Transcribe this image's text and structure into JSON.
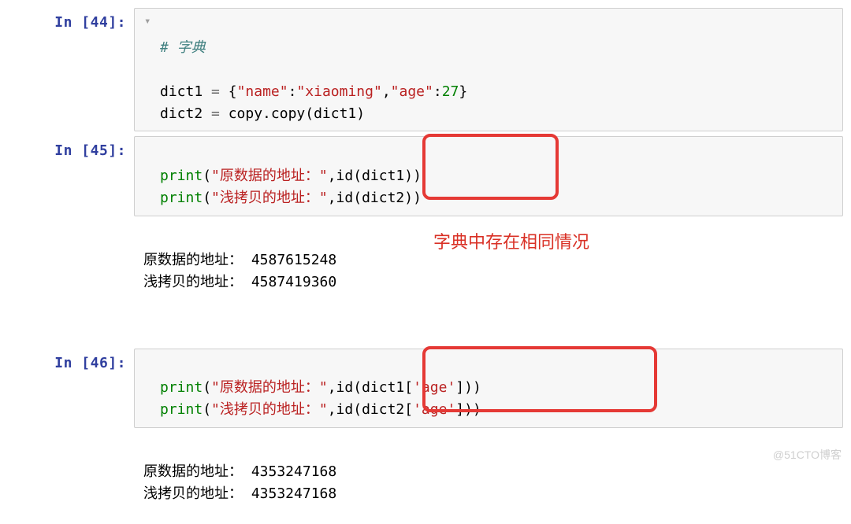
{
  "cells": {
    "c44": {
      "prompt": "In [44]:",
      "comment": "# 字典",
      "line1_a": "dict1 ",
      "line1_eq": "=",
      "line1_b": " {",
      "line1_k1": "\"name\"",
      "line1_colon1": ":",
      "line1_v1": "\"xiaoming\"",
      "line1_comma": ",",
      "line1_k2": "\"age\"",
      "line1_colon2": ":",
      "line1_v2": "27",
      "line1_close": "}",
      "line2": "dict2 ",
      "line2_eq": "=",
      "line2_b": " copy.copy(dict1)"
    },
    "c45": {
      "prompt": "In [45]:",
      "p1": "print",
      "s1": "\"原数据的地址：\"",
      "mid1": ",id(dict1))",
      "p2": "print",
      "s2": "\"浅拷贝的地址：\"",
      "mid2": ",id(dict2))"
    },
    "o45": {
      "line1": "原数据的地址： 4587615248",
      "line2": "浅拷贝的地址： 4587419360"
    },
    "c46": {
      "prompt": "In [46]:",
      "p1": "print",
      "s1": "\"原数据的地址：\"",
      "mid1a": ",id(dict1[",
      "key1": "'age'",
      "mid1b": "]))",
      "p2": "print",
      "s2": "\"浅拷贝的地址：\"",
      "mid2a": ",id(dict2[",
      "key2": "'age'",
      "mid2b": "]))"
    },
    "o46": {
      "line1": "原数据的地址： 4353247168",
      "line2": "浅拷贝的地址： 4353247168"
    }
  },
  "annotation": "字典中存在相同情况",
  "watermark": "@51CTO博客"
}
